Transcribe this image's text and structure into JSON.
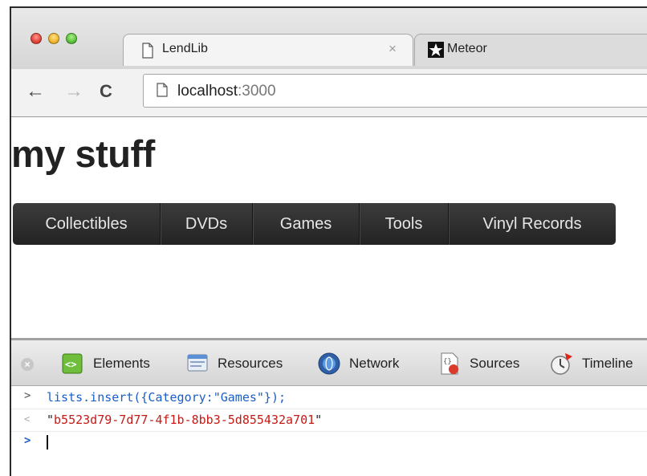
{
  "browser": {
    "tabs": [
      {
        "title": "LendLib",
        "close": "×"
      },
      {
        "title": "Meteor"
      }
    ],
    "nav": {
      "back": "←",
      "forward": "→",
      "reload": "C"
    },
    "address": {
      "host": "localhost",
      "port": ":3000"
    }
  },
  "page": {
    "title": "my stuff",
    "categories": [
      "Collectibles",
      "DVDs",
      "Games",
      "Tools",
      "Vinyl Records"
    ]
  },
  "devtools": {
    "close_glyph": "×",
    "tabs": [
      "Elements",
      "Resources",
      "Network",
      "Sources",
      "Timeline"
    ],
    "console": {
      "command": "lists.insert({Category:\"Games\"});",
      "result": "b5523d79-7d77-4f1b-8bb3-5d855432a701",
      "prompt_glyph": ">",
      "result_glyph": "<"
    }
  },
  "icons": {
    "tab1": "page-icon",
    "tab2": "meteor-star-icon",
    "devtools": [
      "elements-icon",
      "resources-icon",
      "network-icon",
      "sources-icon",
      "timeline-icon"
    ]
  }
}
